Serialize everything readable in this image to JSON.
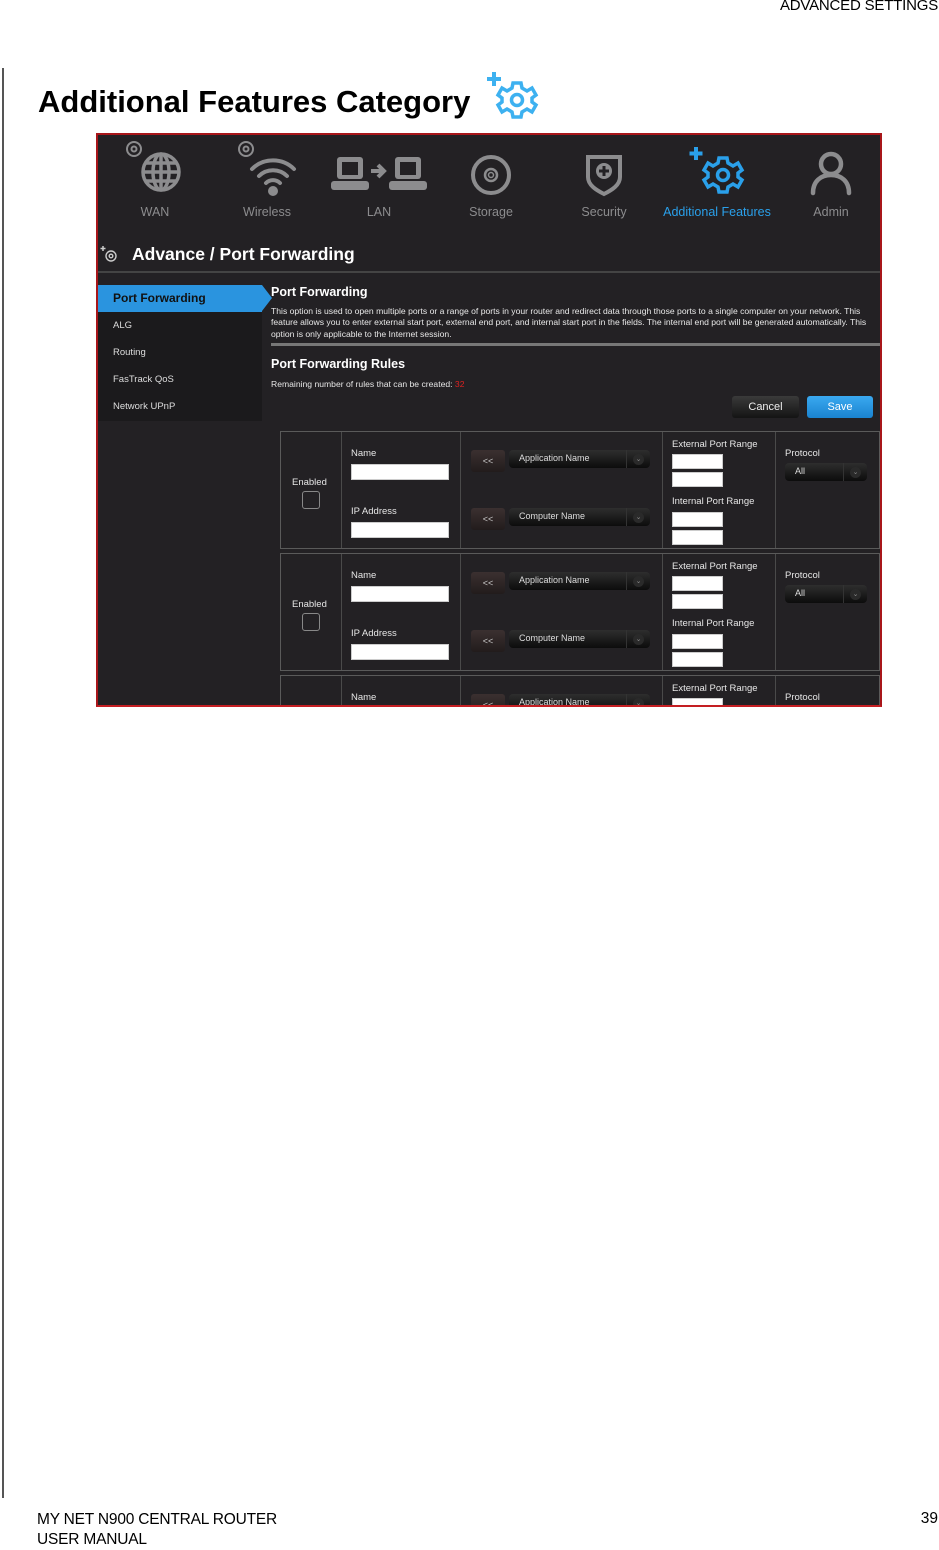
{
  "header": {
    "section": "ADVANCED SETTINGS"
  },
  "page": {
    "title": "Additional Features Category",
    "accent_color": "#2aa0ea"
  },
  "router_ui": {
    "nav": [
      {
        "label": "WAN",
        "icon": "globe-icon",
        "active": false
      },
      {
        "label": "Wireless",
        "icon": "wifi-icon",
        "active": false
      },
      {
        "label": "LAN",
        "icon": "lan-icon",
        "active": false
      },
      {
        "label": "Storage",
        "icon": "disc-icon",
        "active": false
      },
      {
        "label": "Security",
        "icon": "shield-icon",
        "active": false
      },
      {
        "label": "Additional Features",
        "icon": "gear-plus-icon",
        "active": true
      },
      {
        "label": "Admin",
        "icon": "user-icon",
        "active": false
      }
    ],
    "breadcrumb": "Advance / Port Forwarding",
    "sidebar": [
      {
        "label": "Port Forwarding",
        "active": true
      },
      {
        "label": "ALG"
      },
      {
        "label": "Routing"
      },
      {
        "label": "FasTrack QoS"
      },
      {
        "label": "Network UPnP"
      }
    ],
    "section_title": "Port Forwarding",
    "description": "This option is used to open multiple ports or a range of ports in your router and redirect data through those ports to a single computer on your network. This feature allows you to enter external start port, external end port, and internal start port in the fields. The internal end port will be generated automatically. This option is only applicable to the Internet session.",
    "rules_title": "Port Forwarding Rules",
    "remaining_label": "Remaining number of rules that can be created:",
    "remaining_count": "32",
    "cancel_label": "Cancel",
    "save_label": "Save",
    "rule_labels": {
      "enabled": "Enabled",
      "name": "Name",
      "ip_address": "IP Address",
      "copy_button": "<<",
      "application_name": "Application Name",
      "computer_name": "Computer Name",
      "external_port_range": "External Port Range",
      "internal_port_range": "Internal Port Range",
      "protocol": "Protocol",
      "protocol_value": "All"
    }
  },
  "footer": {
    "product": "MY NET N900 CENTRAL ROUTER",
    "doc": "USER MANUAL",
    "page_number": "39"
  }
}
